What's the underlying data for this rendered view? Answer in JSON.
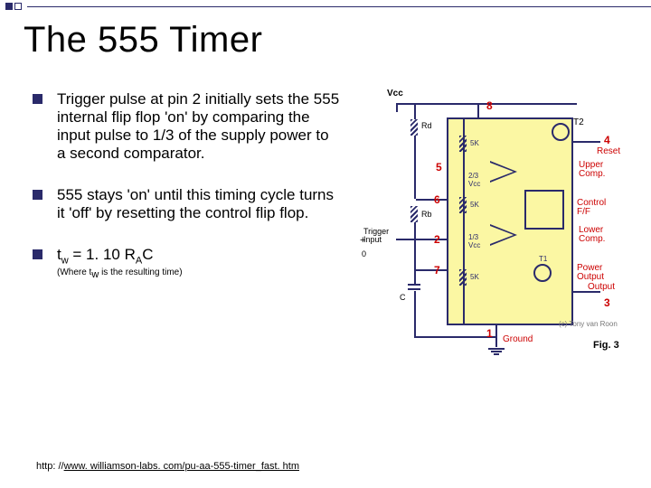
{
  "title": "The 555 Timer",
  "bullets": [
    "Trigger pulse at  pin 2 initially sets the 555 internal flip flop 'on' by comparing the input pulse to 1/3 of the supply power to a second comparator.",
    "555 stays 'on' until this timing cycle turns it 'off' by resetting the control flip flop."
  ],
  "formula": {
    "lhs_base": "t",
    "lhs_sub": "w",
    "rhs_pre": " = 1. 10 R",
    "rhs_sub": "A",
    "rhs_post": "C"
  },
  "formula_note_pre": "(Where t",
  "formula_note_sub": "w",
  "formula_note_post": " is the resulting time)",
  "link_prefix": "http: //",
  "link_url": "www. williamson-labs. com/pu-aa-555-timer_fast. htm",
  "diagram": {
    "pins": {
      "p1": "1",
      "p2": "2",
      "p3": "3",
      "p4": "4",
      "p5": "5",
      "p6": "6",
      "p7": "7",
      "p8": "8"
    },
    "vcc": "Vcc",
    "rd": "Rd",
    "rb": "Rb",
    "c": "C",
    "trigger": "Trigger\nInput",
    "ground": "Ground",
    "signal_plus": "+",
    "signal_zero": "0",
    "t2": "T2",
    "reset": "Reset",
    "upper": "Upper\nComp.",
    "lower": "Lower\nComp.",
    "control": "Control\nF/F",
    "power": "Power\nOutput",
    "output": "Output",
    "r5k": "5K",
    "two_thirds": "2/3\nVcc",
    "one_third": "1/3\nVcc",
    "t1": "T1",
    "credit": "(c) Tony van Roon",
    "fig": "Fig. 3"
  }
}
